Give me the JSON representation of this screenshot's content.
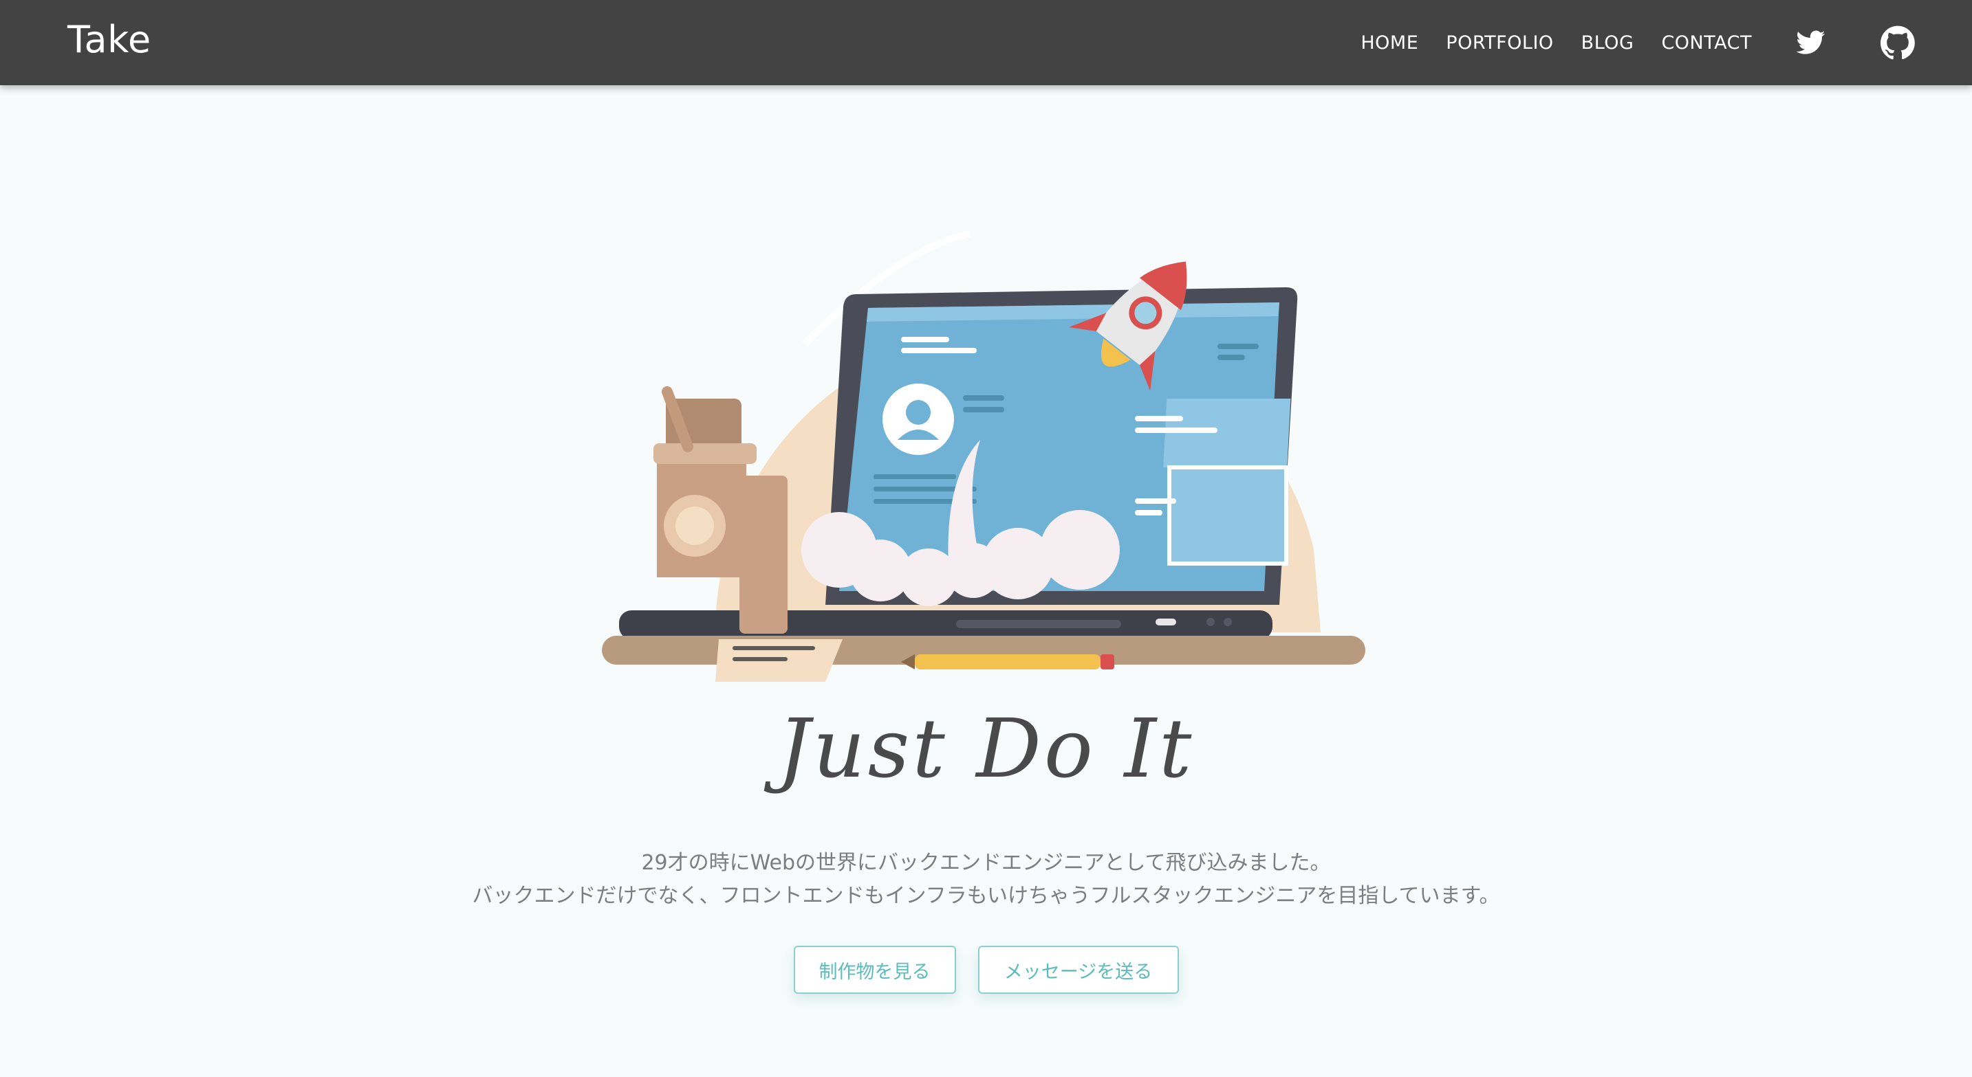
{
  "navbar": {
    "brand": "Take",
    "links": [
      "HOME",
      "PORTFOLIO",
      "BLOG",
      "CONTACT"
    ],
    "icons": [
      "twitter-icon",
      "github-icon"
    ]
  },
  "hero": {
    "headline": "Just Do It",
    "intro_line1": "29才の時にWebの世界にバックエンドエンジニアとして飛び込みました。",
    "intro_line2": "バックエンドだけでなく、フロントエンドもインフラもいけちゃうフルスタックエンジニアを目指しています。",
    "buttons": {
      "works": "制作物を見る",
      "message": "メッセージを送る"
    }
  },
  "colors": {
    "navbar": "#434343",
    "background": "#f7fbfb",
    "accent": "#5bbcbc",
    "text": "#7d7d7d",
    "headline": "#4a4a4a"
  }
}
